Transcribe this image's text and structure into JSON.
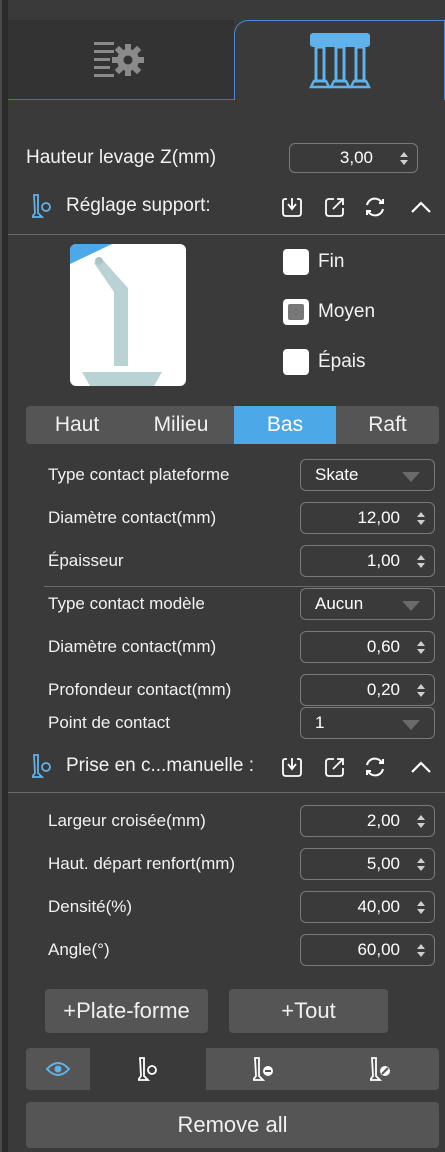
{
  "tabs": [
    {
      "icon": "settings-list-icon",
      "selected": false
    },
    {
      "icon": "support-table-icon",
      "selected": true
    }
  ],
  "lift_height": {
    "label": "Hauteur levage Z(mm)",
    "value": "3,00"
  },
  "support_settings": {
    "title": "Réglage support:",
    "icons": [
      "import-icon",
      "export-icon",
      "reset-icon",
      "collapse-icon"
    ],
    "density_options": [
      {
        "label": "Fin",
        "checked": false
      },
      {
        "label": "Moyen",
        "checked": true
      },
      {
        "label": "Épais",
        "checked": false
      }
    ],
    "segments": [
      {
        "label": "Haut",
        "active": false
      },
      {
        "label": "Milieu",
        "active": false
      },
      {
        "label": "Bas",
        "active": true
      },
      {
        "label": "Raft",
        "active": false
      }
    ],
    "platform_contact_type": {
      "label": "Type contact plateforme",
      "value": "Skate"
    },
    "platform_contact_diameter": {
      "label": "Diamètre contact(mm)",
      "value": "12,00"
    },
    "thickness": {
      "label": "Épaisseur",
      "value": "1,00"
    },
    "model_contact_type": {
      "label": "Type contact modèle",
      "value": "Aucun"
    },
    "model_contact_diameter": {
      "label": "Diamètre contact(mm)",
      "value": "0,60"
    },
    "contact_depth": {
      "label": "Profondeur contact(mm)",
      "value": "0,20"
    },
    "contact_point": {
      "label": "Point de contact",
      "value": "1"
    }
  },
  "manual_support": {
    "title": "Prise en c...manuelle :",
    "cross_width": {
      "label": "Largeur croisée(mm)",
      "value": "2,00"
    },
    "brace_start_height": {
      "label": "Haut. départ renfort(mm)",
      "value": "5,00"
    },
    "density": {
      "label": "Densité(%)",
      "value": "40,00"
    },
    "angle": {
      "label": "Angle(°)",
      "value": "60,00"
    }
  },
  "buttons": {
    "add_platform": "+Plate-forme",
    "add_all": "+Tout",
    "remove_all": "Remove all"
  },
  "mode_bar": [
    "eye-icon",
    "add-support-icon",
    "remove-support-icon",
    "edit-support-icon"
  ],
  "colors": {
    "accent": "#4ca8e6",
    "panel": "#3a3a3a",
    "button": "#555555"
  }
}
